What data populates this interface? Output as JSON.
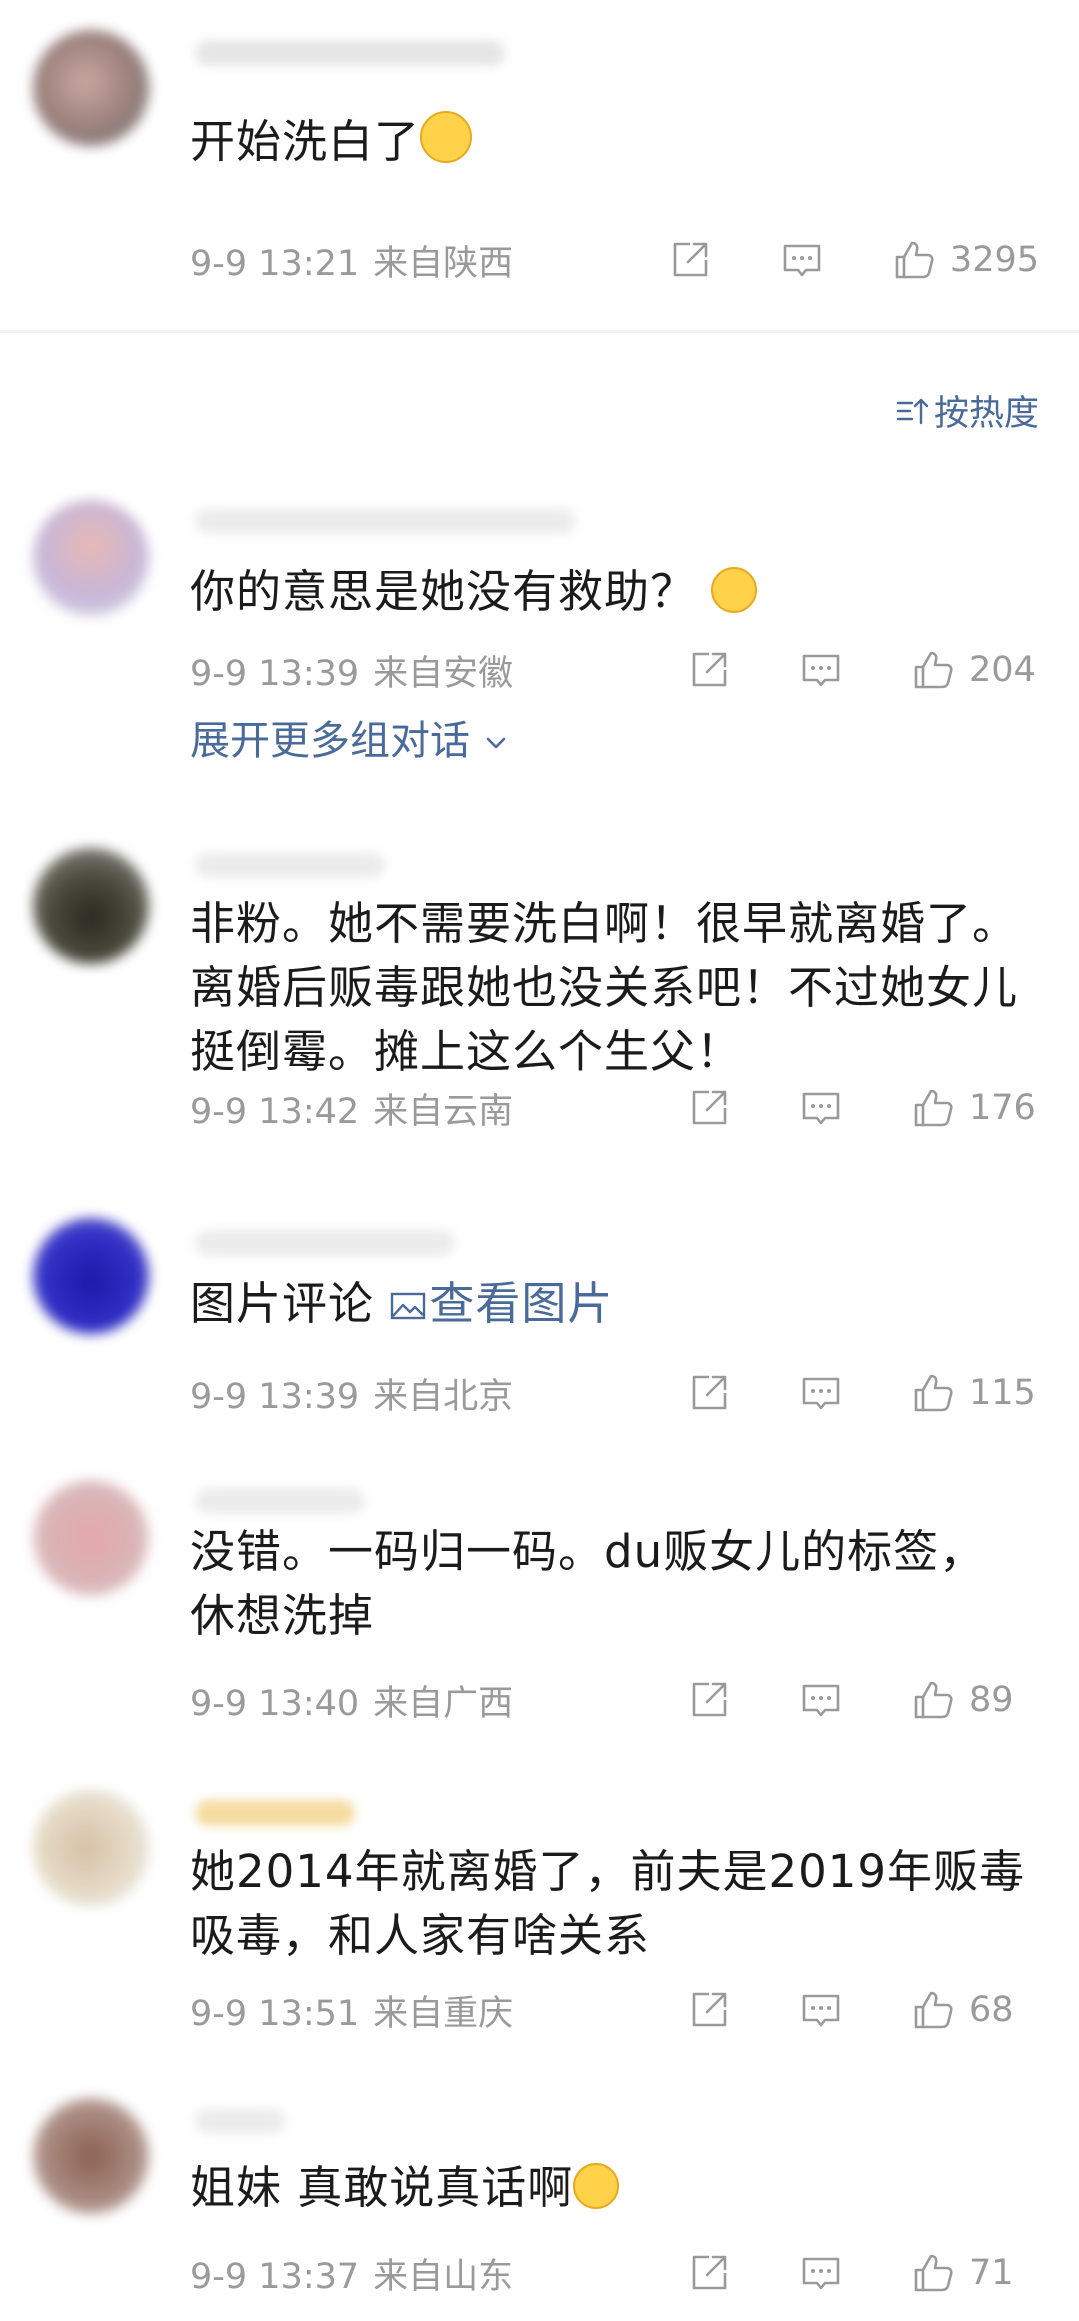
{
  "top_comment": {
    "text": "开始洗白了",
    "time": "9-9 13:21",
    "location": "来自陕西",
    "likes": "3295"
  },
  "sort_label": "按热度",
  "comments": [
    {
      "text": "你的意思是她没有救助？",
      "time": "9-9 13:39",
      "location": "来自安徽",
      "likes": "204"
    },
    {
      "text": "非粉。她不需要洗白啊！很早就离婚了。离婚后贩毒跟她也没关系吧！不过她女儿挺倒霉。摊上这么个生父！",
      "time": "9-9 13:42",
      "location": "来自云南",
      "likes": "176"
    },
    {
      "text": "图片评论",
      "link": "查看图片",
      "time": "9-9 13:39",
      "location": "来自北京",
      "likes": "115"
    },
    {
      "text": "没错。一码归一码。du贩女儿的标签，休想洗掉",
      "time": "9-9 13:40",
      "location": "来自广西",
      "likes": "89"
    },
    {
      "text": "她2014年就离婚了，前夫是2019年贩毒吸毒，和人家有啥关系",
      "time": "9-9 13:51",
      "location": "来自重庆",
      "likes": "68"
    },
    {
      "text": "姐妹 真敢说真话啊",
      "time": "9-9 13:37",
      "location": "来自山东",
      "likes": "71"
    }
  ],
  "expand_label": "展开更多组对话",
  "colors": {
    "link": "#4a6a9a",
    "meta": "#9a9a9a",
    "text": "#1b1b1b"
  },
  "icons": {
    "share": "share-icon",
    "comment": "comment-icon",
    "like": "thumbs-up-icon",
    "sort": "sort-icon",
    "image": "image-icon",
    "chevron": "chevron-down-icon"
  }
}
